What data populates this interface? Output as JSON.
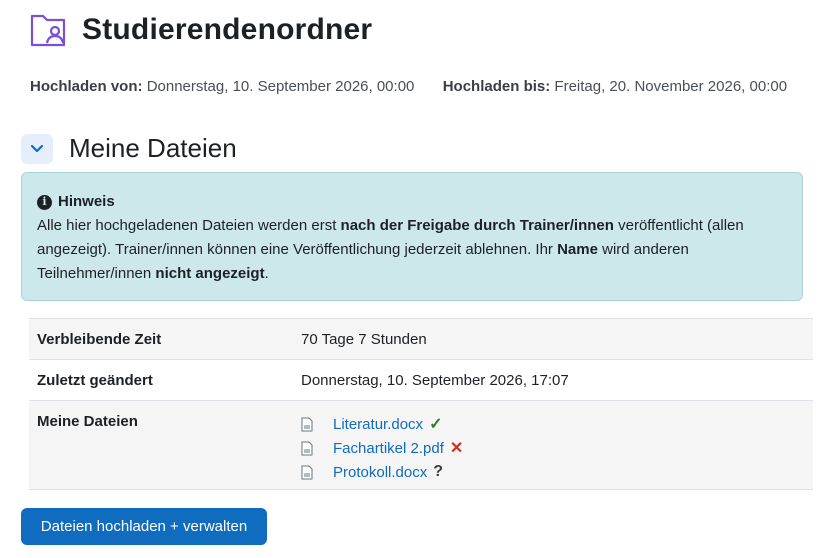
{
  "header": {
    "title": "Studierendenordner",
    "icon": "folder-user-icon",
    "icon_color": "#7b4fd6"
  },
  "dates": {
    "from_label": "Hochladen von:",
    "from_value": "Donnerstag, 10. September 2026, 00:00",
    "to_label": "Hochladen bis:",
    "to_value": "Freitag, 20. November 2026, 00:00"
  },
  "section": {
    "title": "Meine Dateien",
    "toggle_icon": "chevron-down-icon"
  },
  "notice": {
    "title": "Hinweis",
    "t1": "Alle hier hochgeladenen Dateien werden erst ",
    "b1": "nach der Freigabe durch Trainer/innen",
    "t2": " veröffentlicht (allen angezeigt). Trainer/innen können eine Veröffentlichung jederzeit ablehnen. Ihr ",
    "b2": "Name",
    "t3": " wird anderen Teilnehmer/innen ",
    "b3": "nicht angezeigt",
    "t4": ".",
    "bg_color": "#cde8ea"
  },
  "table": {
    "rows": [
      {
        "label": "Verbleibende Zeit",
        "value": "70 Tage 7 Stunden"
      },
      {
        "label": "Zuletzt geändert",
        "value": "Donnerstag, 10. September 2026, 17:07"
      },
      {
        "label": "Meine Dateien"
      }
    ],
    "files": [
      {
        "name": "Literatur.docx",
        "status_symbol": "✓",
        "status": "approved"
      },
      {
        "name": "Fachartikel 2.pdf",
        "status_symbol": "✕",
        "status": "rejected"
      },
      {
        "name": "Protokoll.docx",
        "status_symbol": "?",
        "status": "pending"
      }
    ]
  },
  "button": {
    "label": "Dateien hochladen + verwalten",
    "color": "#0f6cbf"
  }
}
